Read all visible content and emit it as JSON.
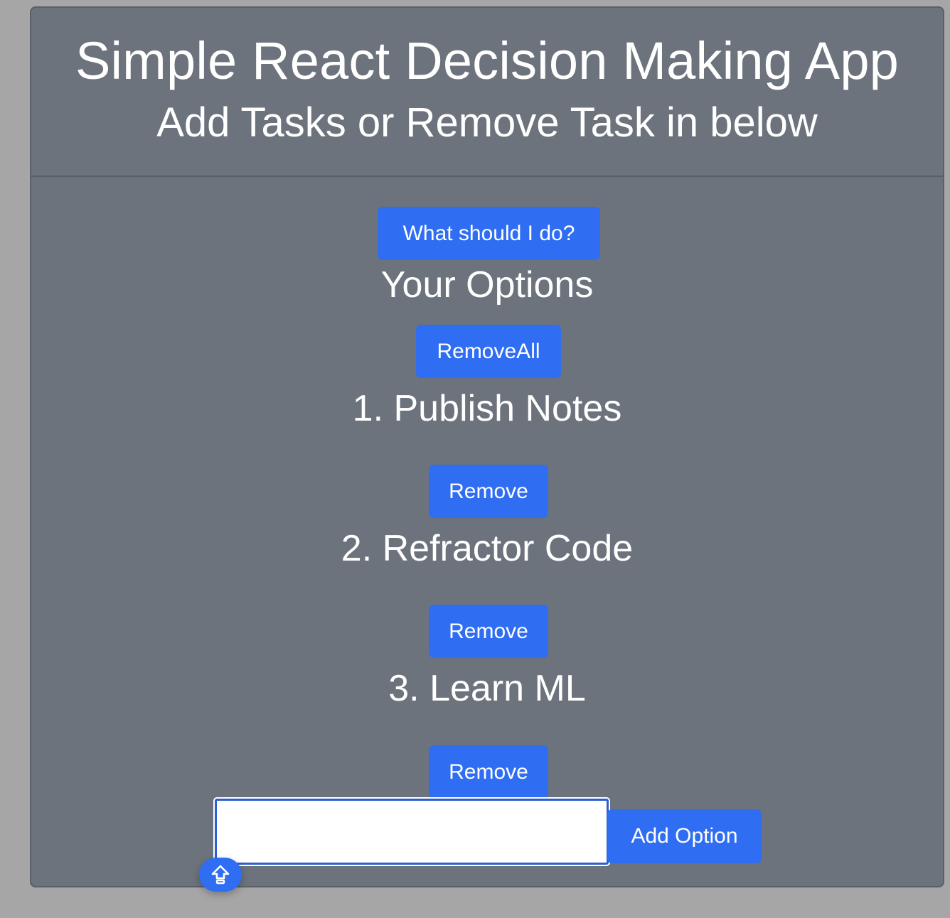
{
  "header": {
    "title": "Simple React Decision Making App",
    "subtitle": "Add Tasks or Remove Task in below"
  },
  "actions": {
    "pick_label": "What should I do?"
  },
  "options_section": {
    "heading": "Your Options",
    "remove_all_label": "RemoveAll",
    "items": [
      {
        "text": "1. Publish Notes",
        "remove_label": "Remove"
      },
      {
        "text": "2. Refractor Code",
        "remove_label": "Remove"
      },
      {
        "text": "3. Learn ML",
        "remove_label": "Remove"
      }
    ]
  },
  "add_form": {
    "input_value": "",
    "button_label": "Add Option"
  },
  "floating_button": {
    "icon": "upload-arrow-icon"
  },
  "colors": {
    "page_background": "#a6a6a6",
    "card_background": "#6c737c",
    "button_primary": "#2f6ef2",
    "text": "#ffffff"
  }
}
